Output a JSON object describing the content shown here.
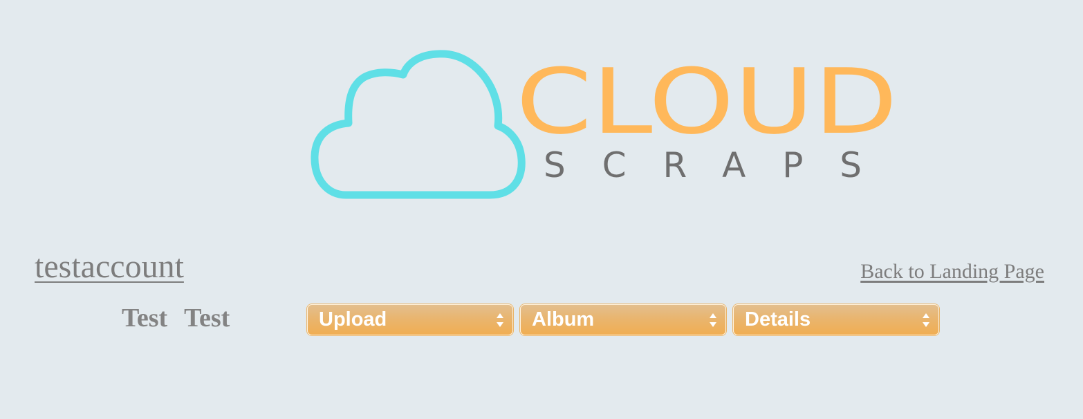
{
  "logo": {
    "word1": "CLOUD",
    "word2": "SCRAPS",
    "colors": {
      "cloud": "#5fdfe6",
      "word1": "#ffb85a",
      "word2": "#6f6f6f"
    }
  },
  "user": {
    "username": "testaccount",
    "first_name": "Test",
    "last_name": "Test"
  },
  "nav": {
    "back_link": "Back to Landing Page"
  },
  "selects": [
    {
      "id": "upload",
      "selected": "Upload"
    },
    {
      "id": "album",
      "selected": "Album"
    },
    {
      "id": "details",
      "selected": "Details"
    }
  ],
  "colors": {
    "background": "#e3eaee",
    "text_gray": "#7d7d7d",
    "select_orange": "#eeb05a"
  }
}
